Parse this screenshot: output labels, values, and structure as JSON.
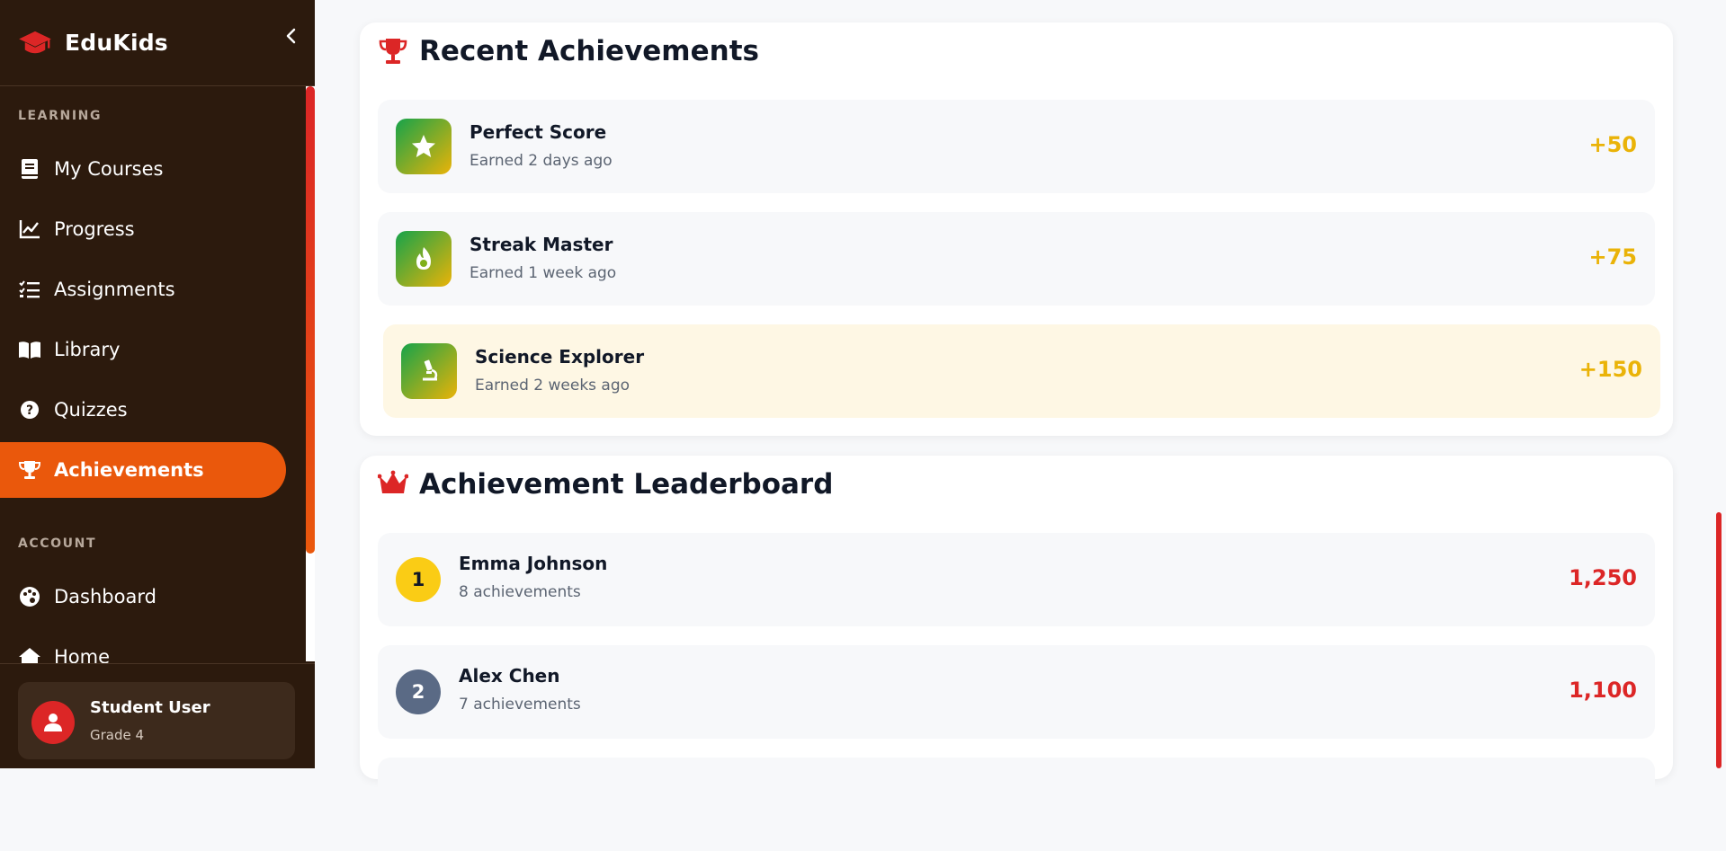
{
  "app": {
    "name": "EduKids"
  },
  "sidebar": {
    "sections": [
      {
        "label": "LEARNING"
      },
      {
        "label": "ACCOUNT"
      }
    ],
    "learning_items": [
      {
        "label": "My Courses",
        "icon": "book-icon"
      },
      {
        "label": "Progress",
        "icon": "chart-line-icon"
      },
      {
        "label": "Assignments",
        "icon": "tasks-icon"
      },
      {
        "label": "Library",
        "icon": "open-book-icon"
      },
      {
        "label": "Quizzes",
        "icon": "question-circle-icon"
      },
      {
        "label": "Achievements",
        "icon": "trophy-icon",
        "active": true
      }
    ],
    "account_items": [
      {
        "label": "Dashboard",
        "icon": "palette-icon"
      },
      {
        "label": "Home",
        "icon": "home-icon"
      }
    ],
    "user": {
      "name": "Student User",
      "grade": "Grade 4"
    }
  },
  "recent": {
    "title": "Recent Achievements",
    "items": [
      {
        "title": "Perfect Score",
        "earned": "Earned 2 days ago",
        "points": "+50",
        "icon": "star-icon"
      },
      {
        "title": "Streak Master",
        "earned": "Earned 1 week ago",
        "points": "+75",
        "icon": "fire-icon"
      },
      {
        "title": "Science Explorer",
        "earned": "Earned 2 weeks ago",
        "points": "+150",
        "icon": "microscope-icon"
      }
    ]
  },
  "leaderboard": {
    "title": "Achievement Leaderboard",
    "items": [
      {
        "rank": "1",
        "name": "Emma Johnson",
        "count": "8 achievements",
        "score": "1,250"
      },
      {
        "rank": "2",
        "name": "Alex Chen",
        "count": "7 achievements",
        "score": "1,100"
      }
    ]
  },
  "colors": {
    "sidebar_bg": "#2c1a0d",
    "accent": "#ea580c",
    "brand_red": "#dc2626",
    "points_gold": "#eab308"
  }
}
